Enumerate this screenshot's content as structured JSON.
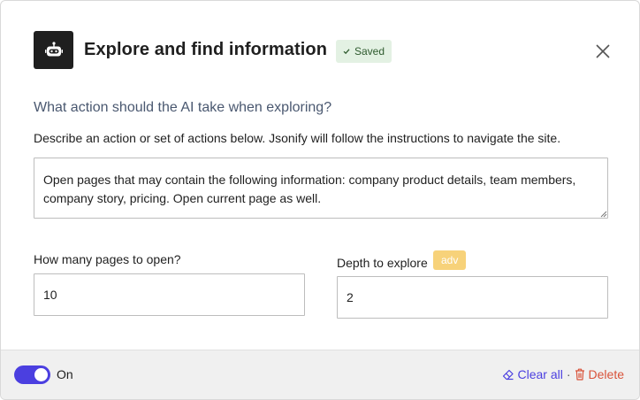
{
  "dialog": {
    "title": "Explore and find information",
    "saved_badge": "Saved",
    "logo_icon": "robot-icon",
    "close_icon": "close-icon"
  },
  "form": {
    "question": "What action should the AI take when exploring?",
    "description": "Describe an action or set of actions below. Jsonify will follow the instructions to navigate the site.",
    "instructions_value": "Open pages that may contain the following information: company product details, team members, company story, pricing. Open current page as well.",
    "pages_label": "How many pages to open?",
    "pages_value": "10",
    "depth_label": "Depth to explore",
    "depth_badge": "adv",
    "depth_value": "2"
  },
  "footer": {
    "toggle_label": "On",
    "toggle_on": true,
    "clear_label": "Clear all",
    "separator": "·",
    "delete_label": "Delete"
  },
  "colors": {
    "accent": "#4b3fe0",
    "delete": "#d9533a",
    "saved_bg": "#e3f1e3",
    "adv_bg": "#f7d27a",
    "question": "#4a5870"
  }
}
